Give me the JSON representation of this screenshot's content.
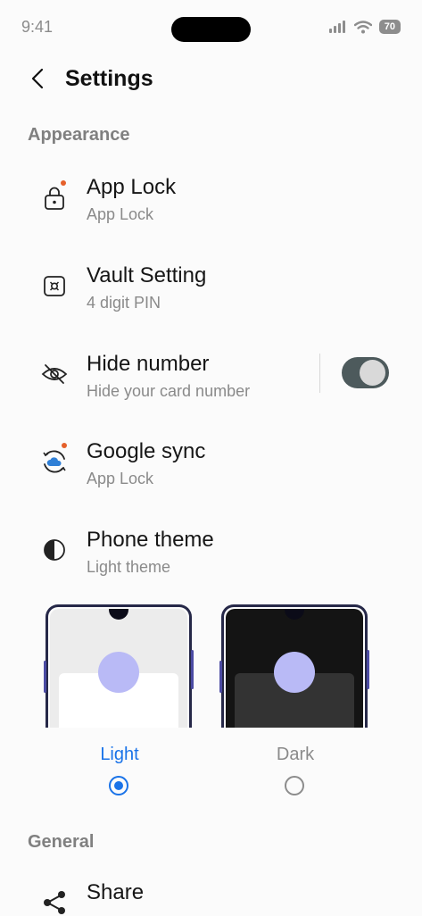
{
  "status_bar": {
    "time": "9:41",
    "battery": "70"
  },
  "header": {
    "title": "Settings"
  },
  "sections": {
    "appearance": "Appearance",
    "general": "General"
  },
  "items": [
    {
      "title": "App Lock",
      "subtitle": "App Lock",
      "icon": "padlock-icon"
    },
    {
      "title": "Vault Setting",
      "subtitle": "4 digit PIN",
      "icon": "vault-icon"
    },
    {
      "title": "Hide number",
      "subtitle": "Hide your card number",
      "icon": "eye-off-icon",
      "toggle_on": true
    },
    {
      "title": "Google sync",
      "subtitle": "App Lock",
      "icon": "cloud-sync-icon"
    },
    {
      "title": "Phone theme",
      "subtitle": "Light theme",
      "icon": "contrast-icon"
    }
  ],
  "theme_options": [
    {
      "label": "Light",
      "selected": true
    },
    {
      "label": "Dark",
      "selected": false
    }
  ],
  "general_items": [
    {
      "title": "Share",
      "icon": "share-icon"
    }
  ],
  "colors": {
    "accent": "#1a73e8",
    "toggle": "#4d5a5c",
    "badge": "#e5602a",
    "preview_circle": "#b9baf6"
  }
}
